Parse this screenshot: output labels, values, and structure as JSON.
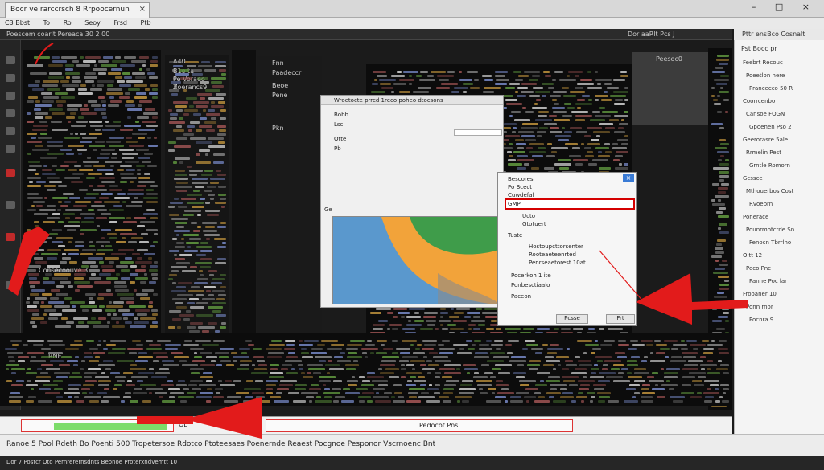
{
  "window": {
    "tab_title": "Bocr ve rarccrsch 8 Rrpoocernun",
    "tab_close": "×",
    "controls": "– □ ×"
  },
  "menubar": [
    "C3 Bbst",
    "To",
    "Ro",
    "Seoy",
    "Frsd",
    "Ptb"
  ],
  "toolbar": {
    "left_text": "Poescem coarlt Pereaca 30 2  00",
    "right_text": "Dor aaRlt  Pcs  J",
    "right_head": "Pttr ensBco   Cosnalt"
  },
  "panes": {
    "b_labels": [
      "A40",
      "B1o ta",
      "Pe Voraeo",
      "Zoerancs9",
      "Ros",
      "Goscemenos",
      "Fescenarit"
    ],
    "d_labels": [
      "Fnn",
      "Paadeccr",
      "Beoe",
      "Pene",
      "Pkn"
    ],
    "e_label": "RNE",
    "f_label": "Peesoc0",
    "a_foot": "Consecoouve 3"
  },
  "dialog_main": {
    "title": "Wroetocte prrcd 1reco poheo dtocsons",
    "rows": [
      "Bobb",
      "Lscl",
      "Otte",
      "Pb"
    ],
    "sub": "Ge"
  },
  "dialog_menu": {
    "items": [
      "Bescores",
      "Po Bcect",
      "Cuwdefal",
      "Ucto",
      "Gtotuert",
      "Tuste",
      "Hostoupcttorsenter",
      "Rooteaeteenrted",
      "Penrseaetorest 10at",
      "Pocerkoh 1 ite",
      "Ponbesctiaalo",
      "Paceon"
    ],
    "highlight": "GMP",
    "buttons": [
      "Pcsse",
      "Frt"
    ]
  },
  "right_panel": {
    "header": "Pst Bocc pr",
    "lines": [
      "Feebrt Recouc",
      "Poeetlon nere",
      "Prancecco 50 R",
      "Coorrcenbo",
      "Cansoe  FOGN",
      "Gpoenen Pso  2",
      "Geerorasre 5ale",
      "Rrmelin Pest",
      "Grntle   Romorn",
      "Gcssce",
      "Mthouerbos  Cost",
      "Rvoeprn",
      "Ponerace",
      "Pounrmotcrde  Sn",
      "Fenocn Tbrrlno",
      "Oltt  12",
      "Peco  Pnc",
      "Panne  Poc  lar",
      "Frooaner 10",
      "Ponn rnor",
      "Pocnra 9"
    ]
  },
  "status": {
    "input2_label": "Pedocot  Pns",
    "small_label": "OL"
  },
  "taskbar": {
    "text": "Ranoe 5 Pool  Rdeth  Bo  Poenti 500  Tropetersoe  Rdotco  Ptoteesaes  Poenernde  Reaest Pocgnoe  Pesponor  Vscrnoenc  Bnt",
    "bottom": "Dor 7 Postcr  Oto  Pernrerernsdnts Beonoe  Proterxndvemtt  10"
  },
  "colors": {
    "arrow": "#e21b1b",
    "highlight": "#d40000",
    "green": "#7ddc6a"
  }
}
